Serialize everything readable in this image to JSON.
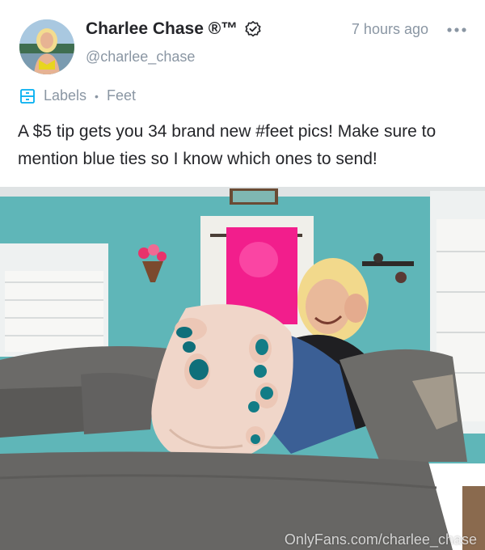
{
  "post": {
    "author_name": "Charlee Chase ®™",
    "handle": "@charlee_chase",
    "timestamp": "7 hours ago",
    "labels_title": "Labels",
    "label_separator": "•",
    "label": "Feet",
    "text": "A $5 tip gets you 34 brand new #feet pics! Make sure to mention blue ties so I know which ones to send!",
    "watermark": "OnlyFans.com/charlee_chase"
  },
  "icons": {
    "verified": "verified-badge-icon",
    "more": "more-options-icon",
    "labels": "labels-icon"
  },
  "colors": {
    "text": "#242529",
    "muted": "#8a96a3",
    "accent": "#00aff0",
    "wall": "#5fb3b6"
  }
}
